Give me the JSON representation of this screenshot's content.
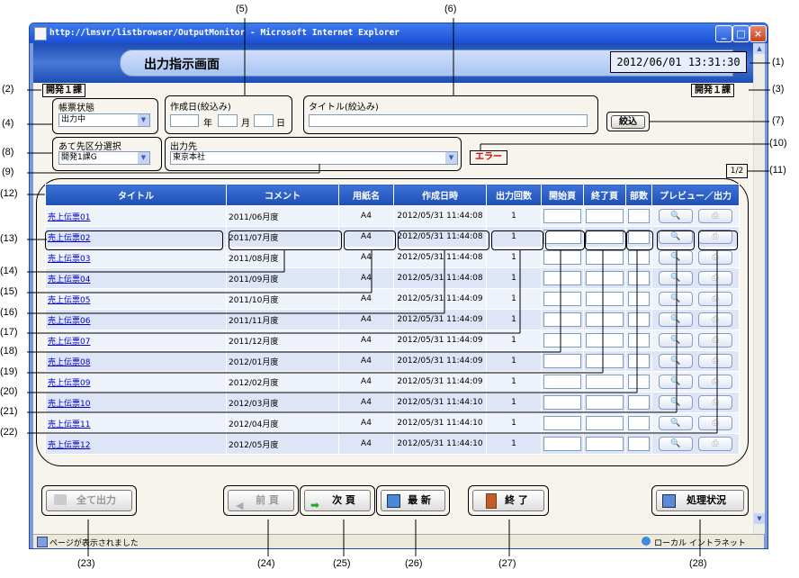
{
  "window": {
    "title": "http://lmsvr/listbrowser/OutputMonitor - Microsoft Internet Explorer"
  },
  "header": {
    "title": "出力指示画面",
    "datetime": "2012/06/01 13:31:30"
  },
  "dept_left": "開発１課",
  "dept_right": "開発１課",
  "filters": {
    "status_label": "帳票状態",
    "status_value": "出力中",
    "date_label": "作成日(絞込み)",
    "year_label": "年",
    "month_label": "月",
    "day_label": "日",
    "title_label": "タイトル(絞込み)",
    "filter_button": "絞込",
    "dest_group_label": "あて先区分選択",
    "dest_group_value": "開発1課G",
    "dest_label": "出力先",
    "dest_value": "東京本社",
    "error_label": "エラー"
  },
  "page_indicator": "1/2",
  "table": {
    "headers": [
      "タイトル",
      "コメント",
      "用紙名",
      "作成日時",
      "出力回数",
      "開始頁",
      "終了頁",
      "部数",
      "プレビュー／出力"
    ],
    "rows": [
      {
        "title": "売上伝票01",
        "comment": "2011/06月度",
        "paper": "A4",
        "created": "2012/05/31 11:44:08",
        "count": "1"
      },
      {
        "title": "売上伝票02",
        "comment": "2011/07月度",
        "paper": "A4",
        "created": "2012/05/31 11:44:08",
        "count": "1"
      },
      {
        "title": "売上伝票03",
        "comment": "2011/08月度",
        "paper": "A4",
        "created": "2012/05/31 11:44:08",
        "count": "1"
      },
      {
        "title": "売上伝票04",
        "comment": "2011/09月度",
        "paper": "A4",
        "created": "2012/05/31 11:44:08",
        "count": "1"
      },
      {
        "title": "売上伝票05",
        "comment": "2011/10月度",
        "paper": "A4",
        "created": "2012/05/31 11:44:09",
        "count": "1"
      },
      {
        "title": "売上伝票06",
        "comment": "2011/11月度",
        "paper": "A4",
        "created": "2012/05/31 11:44:09",
        "count": "1"
      },
      {
        "title": "売上伝票07",
        "comment": "2011/12月度",
        "paper": "A4",
        "created": "2012/05/31 11:44:09",
        "count": "1"
      },
      {
        "title": "売上伝票08",
        "comment": "2012/01月度",
        "paper": "A4",
        "created": "2012/05/31 11:44:09",
        "count": "1"
      },
      {
        "title": "売上伝票09",
        "comment": "2012/02月度",
        "paper": "A4",
        "created": "2012/05/31 11:44:09",
        "count": "1"
      },
      {
        "title": "売上伝票10",
        "comment": "2012/03月度",
        "paper": "A4",
        "created": "2012/05/31 11:44:10",
        "count": "1"
      },
      {
        "title": "売上伝票11",
        "comment": "2012/04月度",
        "paper": "A4",
        "created": "2012/05/31 11:44:10",
        "count": "1"
      },
      {
        "title": "売上伝票12",
        "comment": "2012/05月度",
        "paper": "A4",
        "created": "2012/05/31 11:44:10",
        "count": "1"
      }
    ]
  },
  "buttons": {
    "all_output": "全て出力",
    "prev": "前 頁",
    "next": "次 頁",
    "refresh": "最 新",
    "exit": "終 了",
    "process_status": "処理状況"
  },
  "statusbar": {
    "message": "ページが表示されました",
    "zone": "ローカル イントラネット"
  },
  "callouts": [
    "(1)",
    "(2)",
    "(3)",
    "(4)",
    "(5)",
    "(6)",
    "(7)",
    "(8)",
    "(9)",
    "(10)",
    "(11)",
    "(12)",
    "(13)",
    "(14)",
    "(15)",
    "(16)",
    "(17)",
    "(18)",
    "(19)",
    "(20)",
    "(21)",
    "(22)",
    "(23)",
    "(24)",
    "(25)",
    "(26)",
    "(27)",
    "(28)"
  ],
  "icons": {
    "preview": "magnifier-icon",
    "print": "printer-icon",
    "next_arrow": "green-arrow-icon",
    "prev_arrow": "gray-arrow-icon",
    "exit": "door-icon",
    "refresh": "monitor-icon"
  },
  "colors": {
    "header_blue": "#1e4fb3",
    "error_red": "#e00000",
    "link_blue": "#0000cc"
  }
}
